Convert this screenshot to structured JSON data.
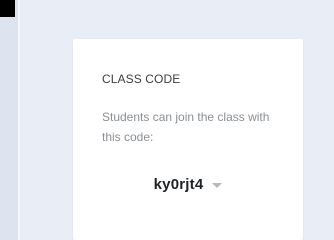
{
  "class_code_card": {
    "title": "CLASS CODE",
    "description": "Students can join the class with this code:",
    "code": "ky0rjt4",
    "code_menu_icon": "chevron-down-icon"
  },
  "colors": {
    "background": "#e8edf6",
    "card": "#ffffff",
    "title_text": "#3c4043",
    "muted_text": "#8a8f94",
    "code_text": "#1f2328"
  }
}
